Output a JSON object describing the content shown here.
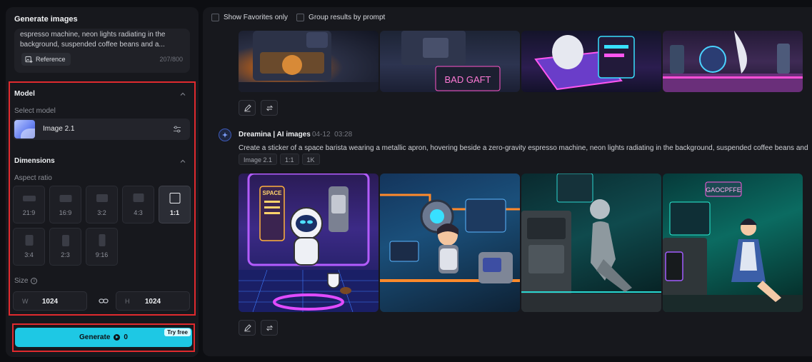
{
  "sidebar": {
    "title": "Generate images",
    "prompt_preview": "espresso machine, neon lights radiating in the background, suspended coffee beans and a...",
    "reference_label": "Reference",
    "char_count": "207/800",
    "model_heading": "Model",
    "select_model_label": "Select model",
    "model_name": "Image 2.1",
    "dimensions_heading": "Dimensions",
    "aspect_ratio_label": "Aspect ratio",
    "ratios": [
      "21:9",
      "16:9",
      "3:2",
      "4:3",
      "1:1",
      "3:4",
      "2:3",
      "9:16"
    ],
    "selected_ratio": "1:1",
    "size_label": "Size",
    "width_prefix": "W",
    "width_value": "1024",
    "height_prefix": "H",
    "height_value": "1024",
    "generate_label": "Generate",
    "credit_value": "0",
    "try_free_label": "Try free"
  },
  "results": {
    "show_favorites_label": "Show Favorites only",
    "group_by_prompt_label": "Group results by prompt",
    "top_tile_text": "BAD GAFT",
    "author": "Dreamina | AI images",
    "date": "04-12",
    "time": "03:28",
    "prompt": "Create a sticker of a space barista wearing a metallic apron, hovering beside a zero-gravity espresso machine, neon lights radiating in the background, suspended coffee beans and",
    "tags": [
      "Image 2.1",
      "1:1",
      "1K"
    ],
    "tile_space_sign": "SPACE",
    "tile_cafe_sign": "GAOCPFFE"
  },
  "colors": {
    "accent": "#1ec8e4",
    "highlight_border": "#e02a2e"
  }
}
